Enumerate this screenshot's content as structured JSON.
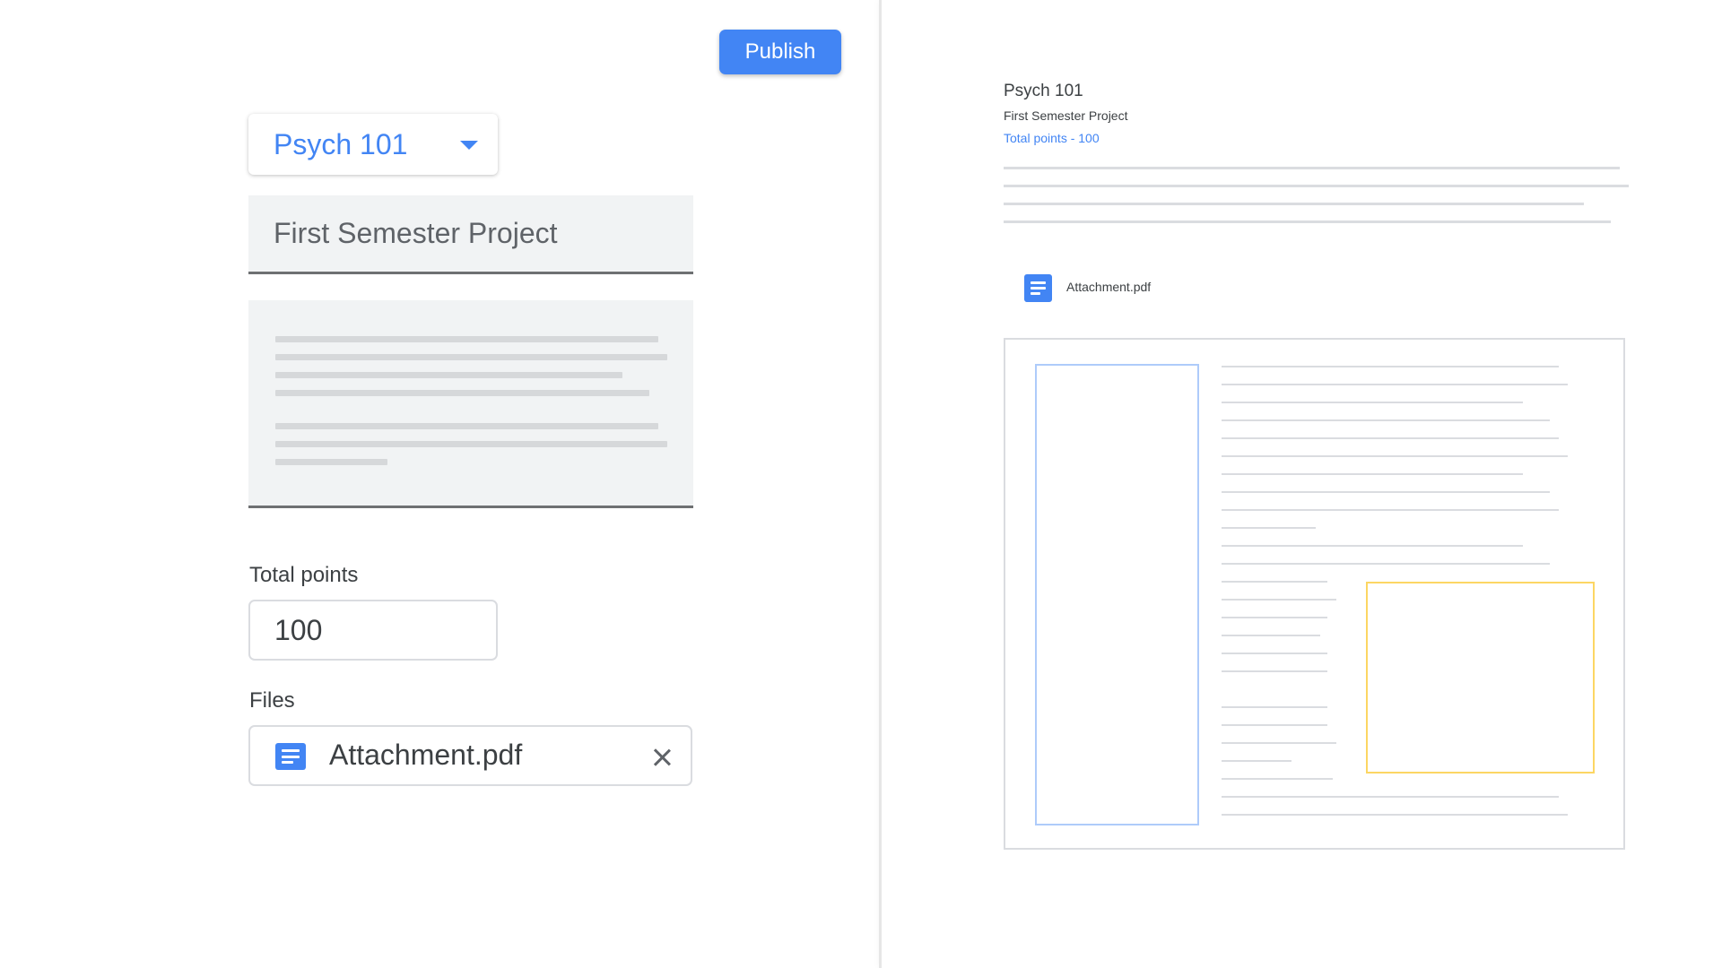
{
  "editor": {
    "publish_label": "Publish",
    "class_select": {
      "value": "Psych 101"
    },
    "title_field": {
      "value": "First Semester Project"
    },
    "total_points": {
      "label": "Total points",
      "value": "100"
    },
    "files": {
      "label": "Files",
      "attachment": {
        "name": "Attachment.pdf",
        "icon": "doc-icon"
      }
    }
  },
  "preview": {
    "class_name": "Psych 101",
    "title": "First Semester Project",
    "points_text": "Total points - 100",
    "attachment": {
      "name": "Attachment.pdf",
      "icon": "doc-icon"
    }
  },
  "colors": {
    "accent": "#4285f4",
    "field_bg": "#f1f3f4",
    "placeholder_line": "#dadce0",
    "highlight_blue": "#aecbfa",
    "highlight_yellow": "#fcd663"
  }
}
